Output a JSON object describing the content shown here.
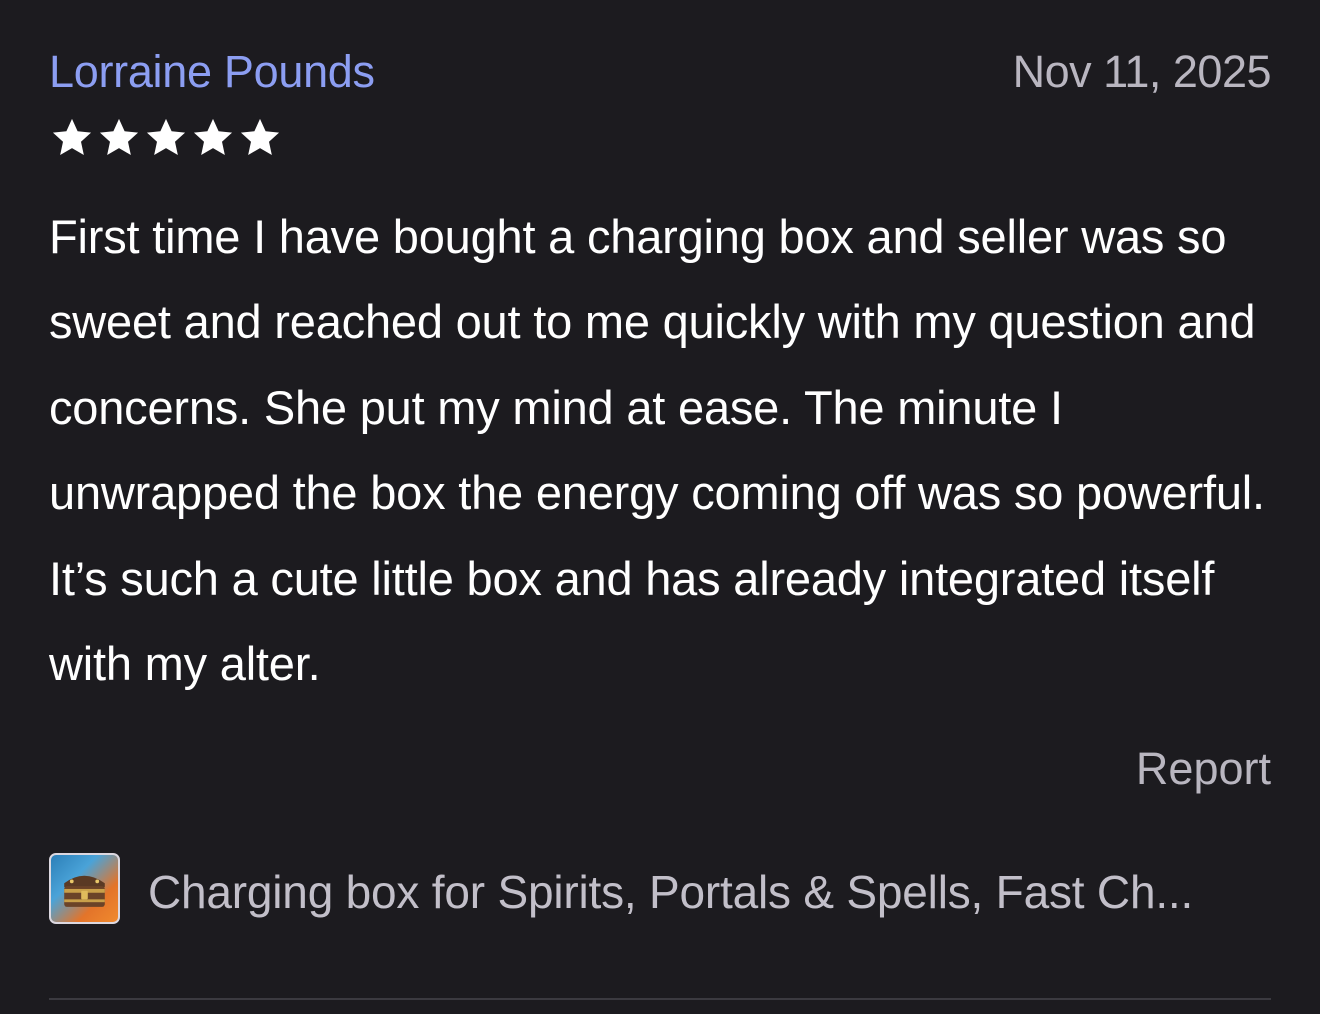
{
  "review": {
    "reviewer_name": "Lorraine Pounds",
    "date": "Nov 11, 2025",
    "rating": 5,
    "rating_max": 5,
    "body": "First time I have bought a charging box and seller was so sweet and reached out to me quickly with my question and concerns. She put my mind at ease. The minute I unwrapped the box the energy coming off was so powerful. It’s such a cute little box and has already integrated itself with my alter.",
    "report_label": "Report"
  },
  "product": {
    "title": "Charging box for Spirits, Portals & Spells, Fast Ch...",
    "thumbnail_icon": "product-thumbnail-treasure-chest"
  },
  "colors": {
    "background": "#1c1b1f",
    "reviewer_name": "#8c9ef2",
    "muted_text": "#b9b6c0",
    "body_text": "#ffffff",
    "star": "#ffffff",
    "divider": "#3b3a40"
  }
}
